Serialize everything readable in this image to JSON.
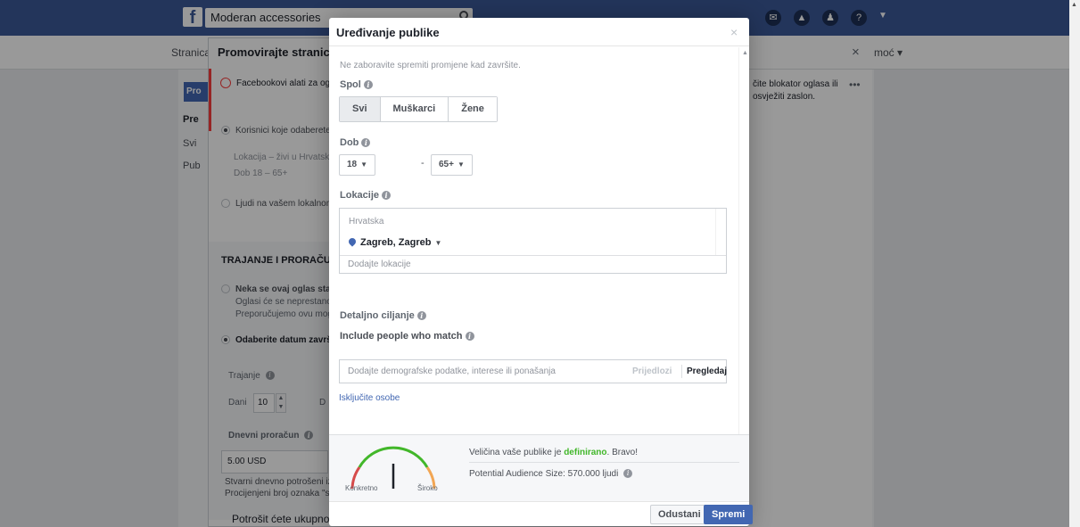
{
  "fb": {
    "logo": "f",
    "search_value": "Moderan accessories",
    "subbar_left": "Stranica",
    "subbar_right": "moć ▾",
    "notice": "čite blokator oglasa ili osvježiti zaslon.",
    "notice_menu": "•••"
  },
  "promote": {
    "title": "Promovirajte stranicu",
    "tab_label": "Pro",
    "nav": [
      "Pre",
      "Svi",
      "Pub"
    ],
    "warning": "Facebookovi alati za og dodajte internetsku adre",
    "audience_option": "Korisnici koje odaberete c",
    "location_line": "Lokacija – živi u Hrvatska",
    "age_line": "Dob 18 – 65+",
    "local_option": "Ljudi na vašem lokalnom",
    "duration_section": "TRAJANJE I PRORAČUN",
    "continuous_title": "Neka se ovaj oglas stalr",
    "continuous_desc1": "Oglasi će se neprestano j",
    "continuous_desc2": "Preporučujemo ovu mogu",
    "choose_date": "Odaberite datum završe",
    "duration_label": "Trajanje",
    "days_label": "Dani",
    "days_value": "10",
    "days_cutoff": "D",
    "daily_budget_label": "Dnevni proračun",
    "daily_budget_value": "5.00 USD",
    "spend_note1": "Stvarni dnevno potrošeni iz",
    "spend_note2": "Procijenjeni broj oznaka \"sv",
    "total_spend": "Potrošit ćete ukupno"
  },
  "modal": {
    "title": "Uređivanje publike",
    "close": "×",
    "hint": "Ne zaboravite spremiti promjene kad završite.",
    "gender_label": "Spol",
    "gender_options": [
      "Svi",
      "Muškarci",
      "Žene"
    ],
    "age_label": "Dob",
    "age_min": "18",
    "age_max": "65+",
    "locations_label": "Lokacije",
    "location_country": "Hrvatska",
    "location_city": "Zagreb, Zagreb",
    "location_add_placeholder": "Dodajte lokacije",
    "detailed_label": "Detaljno ciljanje",
    "include_label": "Include people who match",
    "targeting_placeholder": "Dodajte demografske podatke, interese ili ponašanja",
    "suggestions": "Prijedlozi",
    "browse": "Pregledaj",
    "exclude_link": "Isključite osobe",
    "audience_prefix": "Veličina vaše publike je",
    "audience_status": "definirano",
    "audience_suffix": ". Bravo!",
    "potential_size": "Potential Audience Size: 570.000 ljudi",
    "gauge_left": "Konkretno",
    "gauge_right": "Široko",
    "cancel": "Odustani",
    "save": "Spremi"
  },
  "colors": {
    "fb_blue": "#3b5998",
    "primary": "#4267b2",
    "ok_green": "#42b72a",
    "warning_red": "#fa3e3e"
  }
}
